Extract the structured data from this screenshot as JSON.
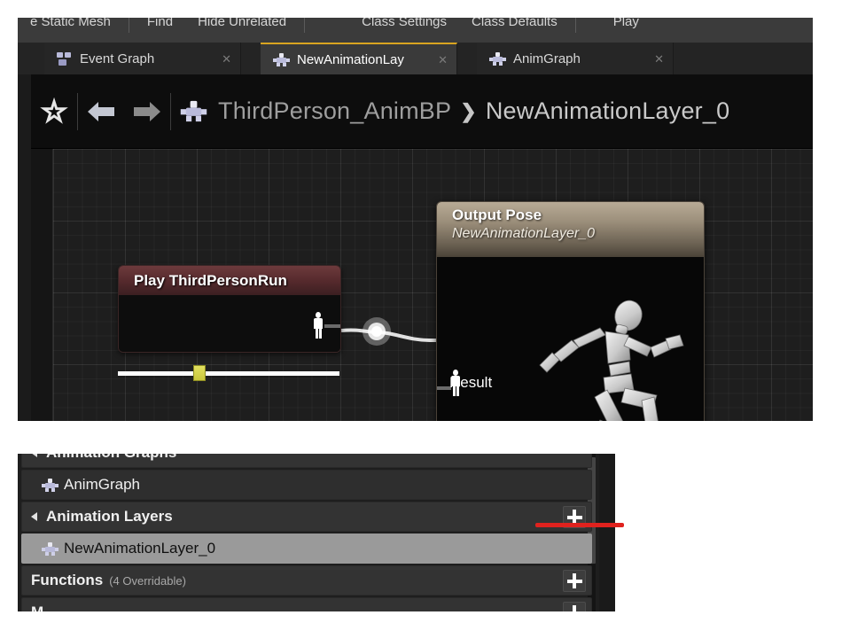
{
  "toolbar": {
    "items": [
      "e Static Mesh",
      "Find",
      "Hide Unrelated",
      "Class Settings",
      "Class Defaults",
      "Play"
    ]
  },
  "tabs": [
    {
      "label": "Event Graph",
      "icon": "event-graph-icon",
      "active": false,
      "close": "✕"
    },
    {
      "label": "NewAnimationLay",
      "icon": "anim-layer-icon",
      "active": true,
      "close": "✕"
    },
    {
      "label": "AnimGraph",
      "icon": "anim-graph-icon",
      "active": false,
      "close": "✕"
    }
  ],
  "breadcrumb": {
    "favorite_icon": "☆",
    "back_icon": "back-arrow-icon",
    "forward_icon": "forward-arrow-icon",
    "blueprint_icon": "anim-blueprint-icon",
    "root": "ThirdPerson_AnimBP",
    "separator": "❯",
    "leaf": "NewAnimationLayer_0"
  },
  "graph": {
    "play_node": {
      "title": "Play ThirdPersonRun",
      "output_pin": "pose-pin-icon",
      "scrubber_value": 34
    },
    "output_node": {
      "title": "Output Pose",
      "subtitle": "NewAnimationLayer_0",
      "result_label": "Result",
      "input_pin": "pose-pin-icon",
      "preview": "running-mannequin-preview"
    }
  },
  "my_blueprint": {
    "rows": [
      {
        "label": "Animation Graphs",
        "type": "category",
        "icon": null,
        "plus": false,
        "selected": false,
        "sub": ""
      },
      {
        "label": "AnimGraph",
        "type": "child",
        "icon": "anim-graph-icon",
        "plus": false,
        "selected": false,
        "sub": ""
      },
      {
        "label": "Animation Layers",
        "type": "category",
        "icon": null,
        "plus": true,
        "selected": false,
        "sub": ""
      },
      {
        "label": "NewAnimationLayer_0",
        "type": "child",
        "icon": "anim-layer-icon",
        "plus": false,
        "selected": true,
        "sub": ""
      },
      {
        "label": "Functions",
        "type": "category",
        "icon": null,
        "plus": true,
        "selected": false,
        "sub": "(4 Overridable)"
      },
      {
        "label": "M",
        "type": "category",
        "icon": null,
        "plus": true,
        "selected": false,
        "sub": ""
      }
    ]
  },
  "annotation": {
    "color": "#e0221e",
    "target": "add-animation-layer-button"
  },
  "colors": {
    "accent_tab": "#d9a520",
    "play_node_header": "#54292c",
    "output_node_header": "#9c8f7b",
    "selection": "#9a9a9a",
    "annotation_red": "#e0221e"
  }
}
